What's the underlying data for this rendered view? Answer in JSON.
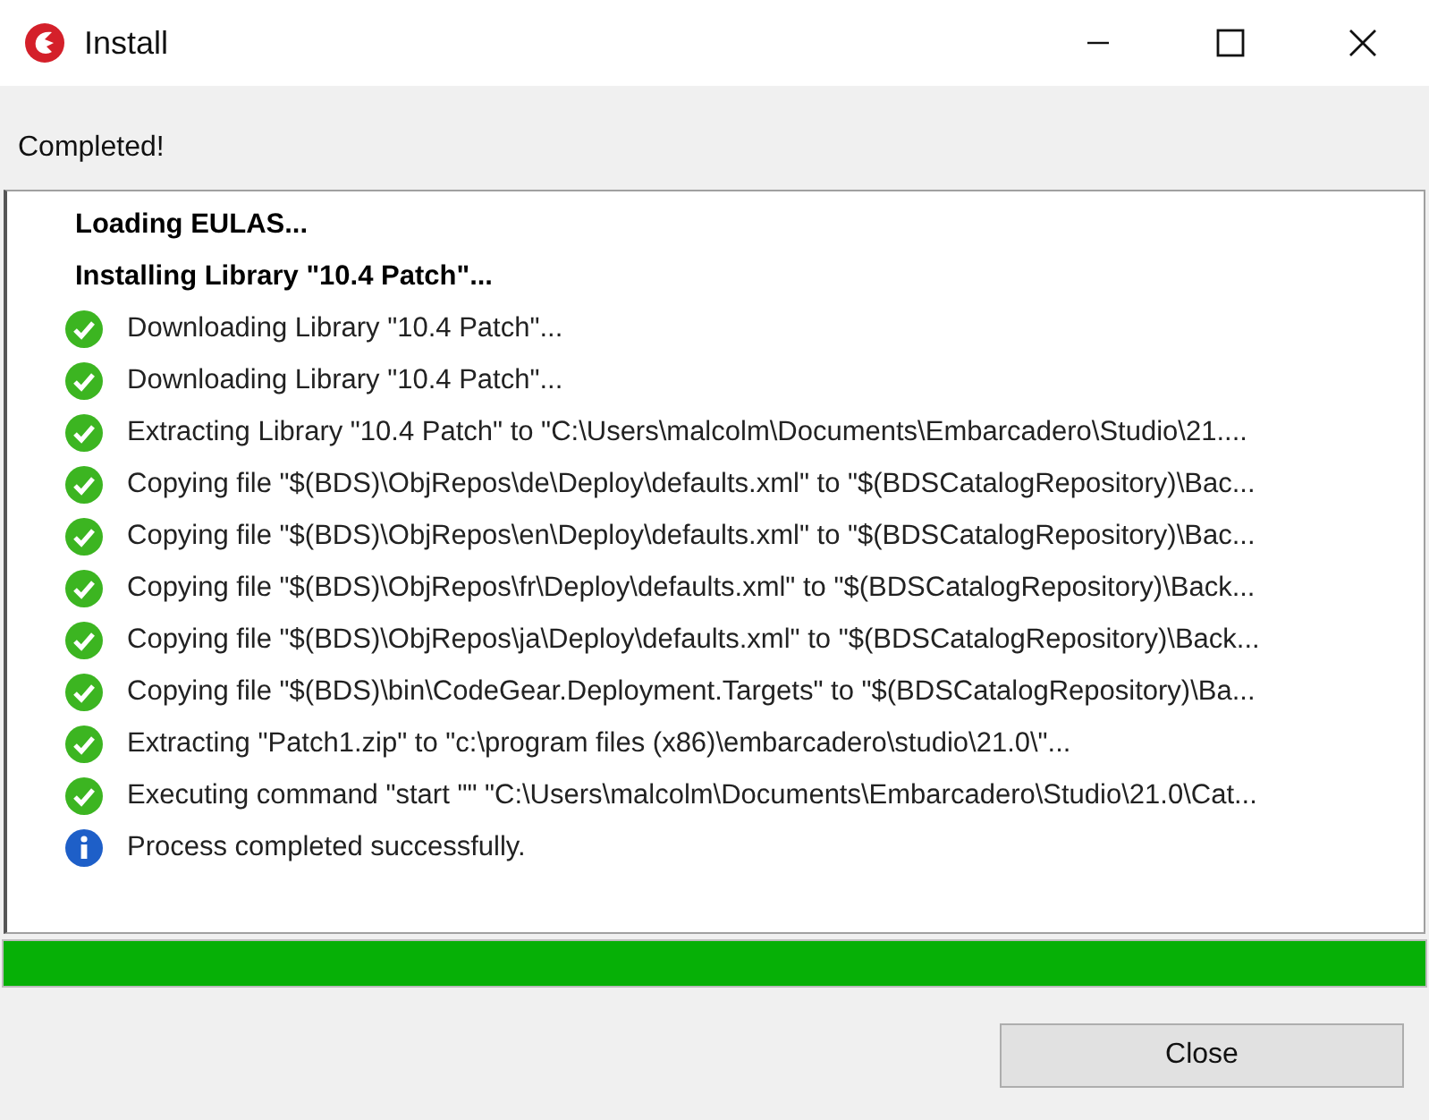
{
  "window": {
    "title": "Install"
  },
  "status": "Completed!",
  "log": [
    {
      "kind": "heading",
      "text": "Loading EULAS..."
    },
    {
      "kind": "heading",
      "text": "Installing Library \"10.4 Patch\"..."
    },
    {
      "kind": "success",
      "text": "Downloading Library \"10.4 Patch\"..."
    },
    {
      "kind": "success",
      "text": "Downloading Library \"10.4 Patch\"..."
    },
    {
      "kind": "success",
      "text": "Extracting Library \"10.4 Patch\" to \"C:\\Users\\malcolm\\Documents\\Embarcadero\\Studio\\21...."
    },
    {
      "kind": "success",
      "text": "Copying file \"$(BDS)\\ObjRepos\\de\\Deploy\\defaults.xml\" to \"$(BDSCatalogRepository)\\Bac..."
    },
    {
      "kind": "success",
      "text": "Copying file \"$(BDS)\\ObjRepos\\en\\Deploy\\defaults.xml\" to \"$(BDSCatalogRepository)\\Bac..."
    },
    {
      "kind": "success",
      "text": "Copying file \"$(BDS)\\ObjRepos\\fr\\Deploy\\defaults.xml\" to \"$(BDSCatalogRepository)\\Back..."
    },
    {
      "kind": "success",
      "text": "Copying file \"$(BDS)\\ObjRepos\\ja\\Deploy\\defaults.xml\" to \"$(BDSCatalogRepository)\\Back..."
    },
    {
      "kind": "success",
      "text": "Copying file \"$(BDS)\\bin\\CodeGear.Deployment.Targets\" to \"$(BDSCatalogRepository)\\Ba..."
    },
    {
      "kind": "success",
      "text": "Extracting \"Patch1.zip\" to \"c:\\program files (x86)\\embarcadero\\studio\\21.0\\\"..."
    },
    {
      "kind": "success",
      "text": "Executing command \"start \"\" \"C:\\Users\\malcolm\\Documents\\Embarcadero\\Studio\\21.0\\Cat..."
    },
    {
      "kind": "info",
      "text": "Process completed successfully."
    }
  ],
  "progress": {
    "level": 1
  },
  "buttons": [
    "Close"
  ]
}
